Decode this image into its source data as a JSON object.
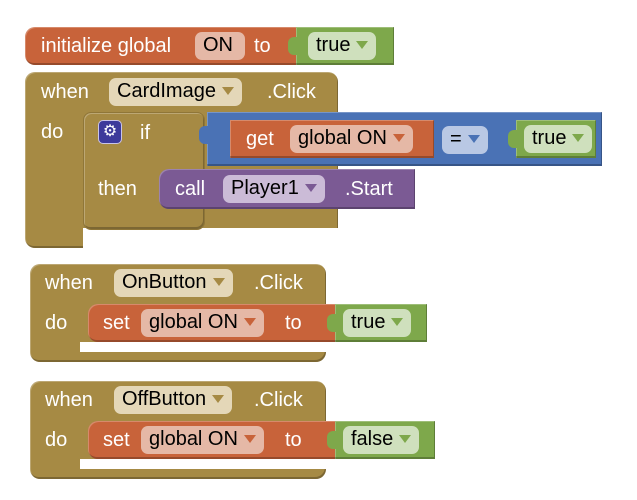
{
  "colors": {
    "variable": "#c8633a",
    "logic": "#7ea84b",
    "event": "#a68a44",
    "control": "#4a72b5",
    "component": "#7b5a94"
  },
  "init_block": {
    "keyword": "initialize global",
    "var_name": "ON",
    "to_label": "to",
    "value": "true"
  },
  "card_click": {
    "when_label": "when",
    "component": "CardImage",
    "event": ".Click",
    "do_label": "do",
    "if_block": {
      "mutator_icon": "gear-icon",
      "if_label": "if",
      "then_label": "then",
      "condition": {
        "get_label": "get",
        "var": "global ON",
        "operator": "=",
        "compare_value": "true"
      },
      "then_call": {
        "call_label": "call",
        "component": "Player1",
        "method": ".Start"
      }
    }
  },
  "on_click": {
    "when_label": "when",
    "component": "OnButton",
    "event": ".Click",
    "do_label": "do",
    "set_label": "set",
    "var": "global ON",
    "to_label": "to",
    "value": "true"
  },
  "off_click": {
    "when_label": "when",
    "component": "OffButton",
    "event": ".Click",
    "do_label": "do",
    "set_label": "set",
    "var": "global ON",
    "to_label": "to",
    "value": "false"
  }
}
